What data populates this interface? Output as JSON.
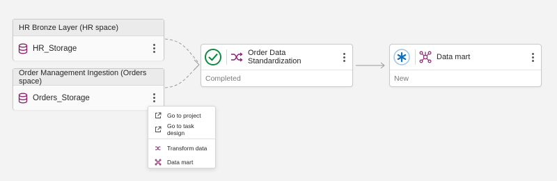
{
  "sources": [
    {
      "header": "HR Bronze Layer (HR space)",
      "label": "HR_Storage",
      "icon": "database-icon"
    },
    {
      "header": "Order Management Ingestion (Orders space)",
      "label": "Orders_Storage",
      "icon": "database-icon"
    }
  ],
  "tasks": [
    {
      "label": "Order Data Standardization",
      "status": "Completed",
      "status_icon": "check-circle-icon",
      "type_icon": "transform-icon"
    },
    {
      "label": "Data mart",
      "status": "New",
      "status_icon": "asterisk-icon",
      "type_icon": "data-mart-icon"
    }
  ],
  "context_menu": {
    "items": [
      {
        "label": "Go to project",
        "icon": "external-link-icon"
      },
      {
        "label": "Go to task design",
        "icon": "external-link-icon"
      },
      {
        "label": "Transform data",
        "icon": "transform-icon"
      },
      {
        "label": "Data mart",
        "icon": "data-mart-icon"
      }
    ]
  },
  "colors": {
    "success": "#0f8a3c",
    "new": "#0b6fc2",
    "accent": "#8a1f6d",
    "edge": "#9a9a9a"
  }
}
